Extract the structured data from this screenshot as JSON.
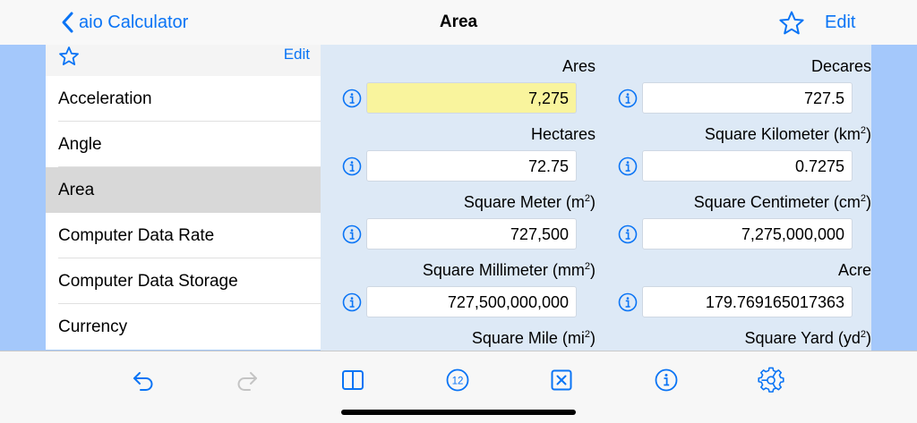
{
  "nav": {
    "back_label": "aio Calculator",
    "title": "Area",
    "edit_label": "Edit"
  },
  "sidebar": {
    "edit_label": "Edit",
    "items": [
      {
        "label": "Acceleration"
      },
      {
        "label": "Angle"
      },
      {
        "label": "Area",
        "selected": true
      },
      {
        "label": "Computer Data Rate"
      },
      {
        "label": "Computer Data Storage"
      },
      {
        "label": "Currency"
      }
    ]
  },
  "main": {
    "fields": [
      {
        "label": "Ares",
        "value": "7,275",
        "active": true
      },
      {
        "label": "Decares",
        "value": "727.5"
      },
      {
        "label": "Hectares",
        "value": "72.75"
      },
      {
        "label": "Square Kilometer (km",
        "sup": "2",
        "tail": ")",
        "value": "0.7275"
      },
      {
        "label": "Square Meter (m",
        "sup": "2",
        "tail": ")",
        "value": "727,500"
      },
      {
        "label": "Square Centimeter (cm",
        "sup": "2",
        "tail": ")",
        "value": "7,275,000,000"
      },
      {
        "label": "Square Millimeter (mm",
        "sup": "2",
        "tail": ")",
        "value": "727,500,000,000"
      },
      {
        "label": "Acre",
        "value": "179.769165017363"
      },
      {
        "label": "Square Mile (mi",
        "sup": "2",
        "tail": ")",
        "value": ""
      },
      {
        "label": "Square Yard (yd",
        "sup": "2",
        "tail": ")",
        "value": ""
      }
    ]
  },
  "toolbar": {
    "items": [
      "undo-icon",
      "redo-icon",
      "split-view-icon",
      "number-format-icon",
      "clear-icon",
      "info-icon",
      "settings-icon"
    ],
    "keypad_label": "12",
    "redo_enabled": false
  },
  "colors": {
    "accent": "#0a74f5",
    "background": "#a4c8fb",
    "panel": "#dde9f6",
    "active_field": "#f9f49d",
    "selected_row": "#d8d8d8"
  }
}
